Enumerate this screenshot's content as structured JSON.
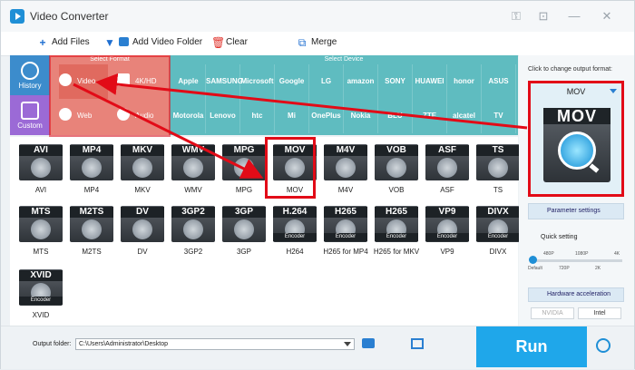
{
  "window": {
    "title": "Video Converter"
  },
  "toolbar": {
    "add_files": "Add Files",
    "add_video_folder": "Add Video Folder",
    "clear": "Clear",
    "merge": "Merge"
  },
  "sidebar": {
    "history": "History",
    "custom": "Custom"
  },
  "format_header": "Select Format",
  "device_header": "Select Device",
  "categories": [
    "Video",
    "4K/HD",
    "Web",
    "Audio"
  ],
  "devices_row1": [
    "Apple",
    "SAMSUNG",
    "Microsoft",
    "Google",
    "LG",
    "amazon",
    "SONY",
    "HUAWEI",
    "honor",
    "ASUS"
  ],
  "devices_row2": [
    "Motorola",
    "Lenovo",
    "htc",
    "Mi",
    "OnePlus",
    "Nokia",
    "BLU",
    "ZTE",
    "alcatel",
    "TV"
  ],
  "formats_row1": [
    {
      "tag": "AVI",
      "name": "AVI"
    },
    {
      "tag": "MP4",
      "name": "MP4"
    },
    {
      "tag": "MKV",
      "name": "MKV"
    },
    {
      "tag": "WMV",
      "name": "WMV"
    },
    {
      "tag": "MPG",
      "name": "MPG"
    },
    {
      "tag": "MOV",
      "name": "MOV"
    },
    {
      "tag": "M4V",
      "name": "M4V"
    },
    {
      "tag": "VOB",
      "name": "VOB"
    },
    {
      "tag": "ASF",
      "name": "ASF"
    },
    {
      "tag": "TS",
      "name": "TS"
    }
  ],
  "formats_row2": [
    {
      "tag": "MTS",
      "name": "MTS"
    },
    {
      "tag": "M2TS",
      "name": "M2TS"
    },
    {
      "tag": "DV",
      "name": "DV"
    },
    {
      "tag": "3GP2",
      "name": "3GP2"
    },
    {
      "tag": "3GP",
      "name": "3GP"
    },
    {
      "tag": "H.264",
      "name": "H264"
    },
    {
      "tag": "H265",
      "name": "H265 for MP4"
    },
    {
      "tag": "H265",
      "name": "H265 for MKV"
    },
    {
      "tag": "VP9",
      "name": "VP9"
    },
    {
      "tag": "DIVX",
      "name": "DIVX"
    }
  ],
  "formats_row3": [
    {
      "tag": "XVID",
      "name": "XVID"
    }
  ],
  "encoder_label": "Encoder",
  "right_panel": {
    "hint": "Click to change output format:",
    "selected_format": "MOV",
    "parameter_settings": "Parameter settings",
    "quick_setting": "Quick setting",
    "ticks_top": [
      "480P",
      "1080P",
      "4K"
    ],
    "ticks_bottom": [
      "Default",
      "720P",
      "2K"
    ],
    "hardware_acceleration": "Hardware acceleration",
    "vendor_nvidia": "NVIDIA",
    "vendor_intel": "Intel"
  },
  "bottom": {
    "output_folder_label": "Output folder:",
    "output_path": "C:\\Users\\Administrator\\Desktop",
    "run": "Run"
  },
  "colors": {
    "accent": "#1fa7ea",
    "highlight": "#e20b17",
    "format_band": "#e8837a",
    "device_band": "#5fbcc0"
  }
}
